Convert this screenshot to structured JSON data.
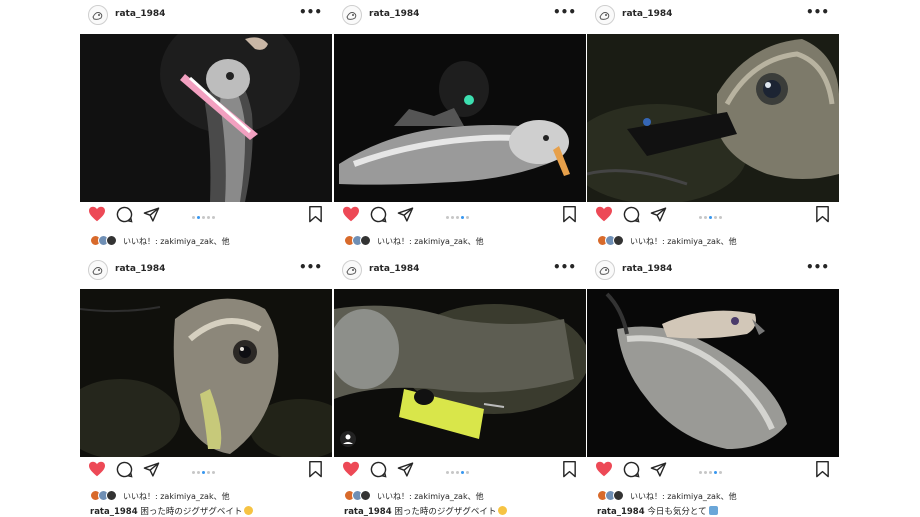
{
  "username": "rata_1984",
  "more_label": "•••",
  "likes_text": "いいね！: zakimiya_zak、他",
  "colors": {
    "heart": "#ed4956",
    "dot_active": "#3897f0",
    "dot_inactive": "#c7c7c7"
  },
  "posts": [
    {
      "caption_user": "",
      "caption_text": "",
      "carousel_active": 2
    },
    {
      "caption_user": "",
      "caption_text": "",
      "carousel_active": 3
    },
    {
      "caption_user": "",
      "caption_text": "",
      "carousel_active": 2
    },
    {
      "caption_user": "rata_1984",
      "caption_text": "困った時のジグザグベイト",
      "carousel_active": 2
    },
    {
      "caption_user": "rata_1984",
      "caption_text": "困った時のジグザグベイト",
      "carousel_active": 3
    },
    {
      "caption_user": "rata_1984",
      "caption_text": "今日も気分とて",
      "carousel_active": 3
    }
  ]
}
